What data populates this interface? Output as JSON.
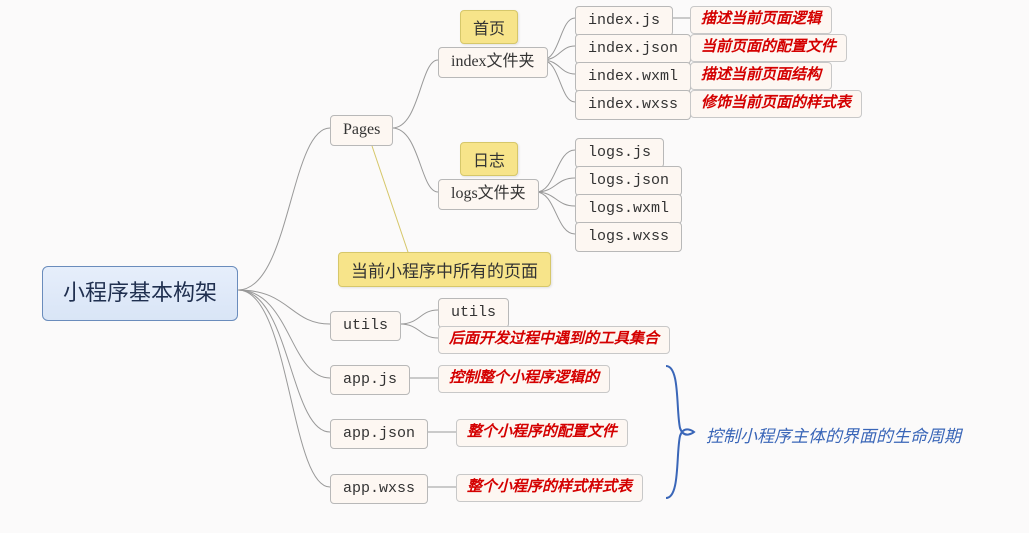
{
  "root": "小程序基本构架",
  "pages": "Pages",
  "pages_note": "当前小程序中所有的页面",
  "index_folder": "index文件夹",
  "index_tag": "首页",
  "logs_folder": "logs文件夹",
  "logs_tag": "日志",
  "index_files": {
    "js": "index.js",
    "json": "index.json",
    "wxml": "index.wxml",
    "wxss": "index.wxss"
  },
  "index_desc": {
    "js": "描述当前页面逻辑",
    "json": "当前页面的配置文件",
    "wxml": "描述当前页面结构",
    "wxss": "修饰当前页面的样式表"
  },
  "logs_files": {
    "js": "logs.js",
    "json": "logs.json",
    "wxml": "logs.wxml",
    "wxss": "logs.wxss"
  },
  "utils": "utils",
  "utils_child": "utils",
  "utils_desc": "后面开发过程中遇到的工具集合",
  "appjs": "app.js",
  "appjs_desc": "控制整个小程序逻辑的",
  "appjson": "app.json",
  "appjson_desc": "整个小程序的配置文件",
  "appwxss": "app.wxss",
  "appwxss_desc": "整个小程序的样式样式表",
  "lifecycle_note": "控制小程序主体的界面的生命周期"
}
